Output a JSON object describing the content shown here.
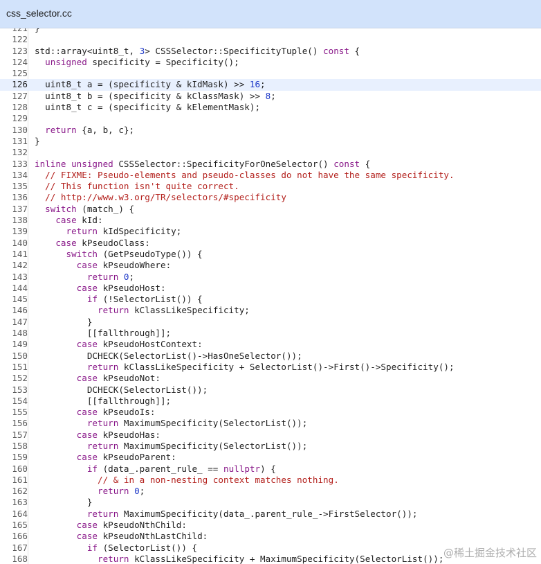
{
  "tab": {
    "title": "css_selector.cc"
  },
  "active_line": "126",
  "code_lines": [
    {
      "n": "121",
      "segs": [
        {
          "t": "}"
        }
      ]
    },
    {
      "n": "122",
      "segs": []
    },
    {
      "n": "123",
      "segs": [
        {
          "t": "std::array<uint8_t, "
        },
        {
          "t": "3",
          "c": "num"
        },
        {
          "t": "> CSSSelector::SpecificityTuple() "
        },
        {
          "t": "const",
          "c": "kw"
        },
        {
          "t": " {"
        }
      ]
    },
    {
      "n": "124",
      "segs": [
        {
          "t": "  "
        },
        {
          "t": "unsigned",
          "c": "kw"
        },
        {
          "t": " specificity = Specificity();"
        }
      ]
    },
    {
      "n": "125",
      "segs": []
    },
    {
      "n": "126",
      "segs": [
        {
          "t": "  uint8_t a = (specificity & kIdMask) >> "
        },
        {
          "t": "16",
          "c": "num"
        },
        {
          "t": ";"
        }
      ]
    },
    {
      "n": "127",
      "segs": [
        {
          "t": "  uint8_t b = (specificity & kClassMask) >> "
        },
        {
          "t": "8",
          "c": "num"
        },
        {
          "t": ";"
        }
      ]
    },
    {
      "n": "128",
      "segs": [
        {
          "t": "  uint8_t c = (specificity & kElementMask);"
        }
      ]
    },
    {
      "n": "129",
      "segs": []
    },
    {
      "n": "130",
      "segs": [
        {
          "t": "  "
        },
        {
          "t": "return",
          "c": "kw"
        },
        {
          "t": " {a, b, c};"
        }
      ]
    },
    {
      "n": "131",
      "segs": [
        {
          "t": "}"
        }
      ]
    },
    {
      "n": "132",
      "segs": []
    },
    {
      "n": "133",
      "segs": [
        {
          "t": "inline",
          "c": "kw"
        },
        {
          "t": " "
        },
        {
          "t": "unsigned",
          "c": "kw"
        },
        {
          "t": " CSSSelector::SpecificityForOneSelector() "
        },
        {
          "t": "const",
          "c": "kw"
        },
        {
          "t": " {"
        }
      ]
    },
    {
      "n": "134",
      "segs": [
        {
          "t": "  "
        },
        {
          "t": "// FIXME: Pseudo-elements and pseudo-classes do not have the same specificity.",
          "c": "cm"
        }
      ]
    },
    {
      "n": "135",
      "segs": [
        {
          "t": "  "
        },
        {
          "t": "// This function isn't quite correct.",
          "c": "cm"
        }
      ]
    },
    {
      "n": "136",
      "segs": [
        {
          "t": "  "
        },
        {
          "t": "// http://www.w3.org/TR/selectors/#specificity",
          "c": "cm"
        }
      ]
    },
    {
      "n": "137",
      "segs": [
        {
          "t": "  "
        },
        {
          "t": "switch",
          "c": "kw"
        },
        {
          "t": " (match_) {"
        }
      ]
    },
    {
      "n": "138",
      "segs": [
        {
          "t": "    "
        },
        {
          "t": "case",
          "c": "kw"
        },
        {
          "t": " kId:"
        }
      ]
    },
    {
      "n": "139",
      "segs": [
        {
          "t": "      "
        },
        {
          "t": "return",
          "c": "kw"
        },
        {
          "t": " kIdSpecificity;"
        }
      ]
    },
    {
      "n": "140",
      "segs": [
        {
          "t": "    "
        },
        {
          "t": "case",
          "c": "kw"
        },
        {
          "t": " kPseudoClass:"
        }
      ]
    },
    {
      "n": "141",
      "segs": [
        {
          "t": "      "
        },
        {
          "t": "switch",
          "c": "kw"
        },
        {
          "t": " (GetPseudoType()) {"
        }
      ]
    },
    {
      "n": "142",
      "segs": [
        {
          "t": "        "
        },
        {
          "t": "case",
          "c": "kw"
        },
        {
          "t": " kPseudoWhere:"
        }
      ]
    },
    {
      "n": "143",
      "segs": [
        {
          "t": "          "
        },
        {
          "t": "return",
          "c": "kw"
        },
        {
          "t": " "
        },
        {
          "t": "0",
          "c": "num"
        },
        {
          "t": ";"
        }
      ]
    },
    {
      "n": "144",
      "segs": [
        {
          "t": "        "
        },
        {
          "t": "case",
          "c": "kw"
        },
        {
          "t": " kPseudoHost:"
        }
      ]
    },
    {
      "n": "145",
      "segs": [
        {
          "t": "          "
        },
        {
          "t": "if",
          "c": "kw"
        },
        {
          "t": " (!SelectorList()) {"
        }
      ]
    },
    {
      "n": "146",
      "segs": [
        {
          "t": "            "
        },
        {
          "t": "return",
          "c": "kw"
        },
        {
          "t": " kClassLikeSpecificity;"
        }
      ]
    },
    {
      "n": "147",
      "segs": [
        {
          "t": "          }"
        }
      ]
    },
    {
      "n": "148",
      "segs": [
        {
          "t": "          [[fallthrough]];"
        }
      ]
    },
    {
      "n": "149",
      "segs": [
        {
          "t": "        "
        },
        {
          "t": "case",
          "c": "kw"
        },
        {
          "t": " kPseudoHostContext:"
        }
      ]
    },
    {
      "n": "150",
      "segs": [
        {
          "t": "          DCHECK(SelectorList()->HasOneSelector());"
        }
      ]
    },
    {
      "n": "151",
      "segs": [
        {
          "t": "          "
        },
        {
          "t": "return",
          "c": "kw"
        },
        {
          "t": " kClassLikeSpecificity + SelectorList()->First()->Specificity();"
        }
      ]
    },
    {
      "n": "152",
      "segs": [
        {
          "t": "        "
        },
        {
          "t": "case",
          "c": "kw"
        },
        {
          "t": " kPseudoNot:"
        }
      ]
    },
    {
      "n": "153",
      "segs": [
        {
          "t": "          DCHECK(SelectorList());"
        }
      ]
    },
    {
      "n": "154",
      "segs": [
        {
          "t": "          [[fallthrough]];"
        }
      ]
    },
    {
      "n": "155",
      "segs": [
        {
          "t": "        "
        },
        {
          "t": "case",
          "c": "kw"
        },
        {
          "t": " kPseudoIs:"
        }
      ]
    },
    {
      "n": "156",
      "segs": [
        {
          "t": "          "
        },
        {
          "t": "return",
          "c": "kw"
        },
        {
          "t": " MaximumSpecificity(SelectorList());"
        }
      ]
    },
    {
      "n": "157",
      "segs": [
        {
          "t": "        "
        },
        {
          "t": "case",
          "c": "kw"
        },
        {
          "t": " kPseudoHas:"
        }
      ]
    },
    {
      "n": "158",
      "segs": [
        {
          "t": "          "
        },
        {
          "t": "return",
          "c": "kw"
        },
        {
          "t": " MaximumSpecificity(SelectorList());"
        }
      ]
    },
    {
      "n": "159",
      "segs": [
        {
          "t": "        "
        },
        {
          "t": "case",
          "c": "kw"
        },
        {
          "t": " kPseudoParent:"
        }
      ]
    },
    {
      "n": "160",
      "segs": [
        {
          "t": "          "
        },
        {
          "t": "if",
          "c": "kw"
        },
        {
          "t": " (data_.parent_rule_ == "
        },
        {
          "t": "nullptr",
          "c": "kw"
        },
        {
          "t": ") {"
        }
      ]
    },
    {
      "n": "161",
      "segs": [
        {
          "t": "            "
        },
        {
          "t": "// & in a non-nesting context matches nothing.",
          "c": "cm"
        }
      ]
    },
    {
      "n": "162",
      "segs": [
        {
          "t": "            "
        },
        {
          "t": "return",
          "c": "kw"
        },
        {
          "t": " "
        },
        {
          "t": "0",
          "c": "num"
        },
        {
          "t": ";"
        }
      ]
    },
    {
      "n": "163",
      "segs": [
        {
          "t": "          }"
        }
      ]
    },
    {
      "n": "164",
      "segs": [
        {
          "t": "          "
        },
        {
          "t": "return",
          "c": "kw"
        },
        {
          "t": " MaximumSpecificity(data_.parent_rule_->FirstSelector());"
        }
      ]
    },
    {
      "n": "165",
      "segs": [
        {
          "t": "        "
        },
        {
          "t": "case",
          "c": "kw"
        },
        {
          "t": " kPseudoNthChild:"
        }
      ]
    },
    {
      "n": "166",
      "segs": [
        {
          "t": "        "
        },
        {
          "t": "case",
          "c": "kw"
        },
        {
          "t": " kPseudoNthLastChild:"
        }
      ]
    },
    {
      "n": "167",
      "segs": [
        {
          "t": "          "
        },
        {
          "t": "if",
          "c": "kw"
        },
        {
          "t": " (SelectorList()) {"
        }
      ]
    },
    {
      "n": "168",
      "segs": [
        {
          "t": "            "
        },
        {
          "t": "return",
          "c": "kw"
        },
        {
          "t": " kClassLikeSpecificity + MaximumSpecificity(SelectorList());"
        }
      ]
    }
  ],
  "watermark": "@稀土掘金技术社区",
  "colors": {
    "tab_bg": "#d2e3fb",
    "keyword": "#8a1a8a",
    "number": "#1a35c7",
    "comment": "#b3201c",
    "active_line": "#e8f0fe"
  }
}
